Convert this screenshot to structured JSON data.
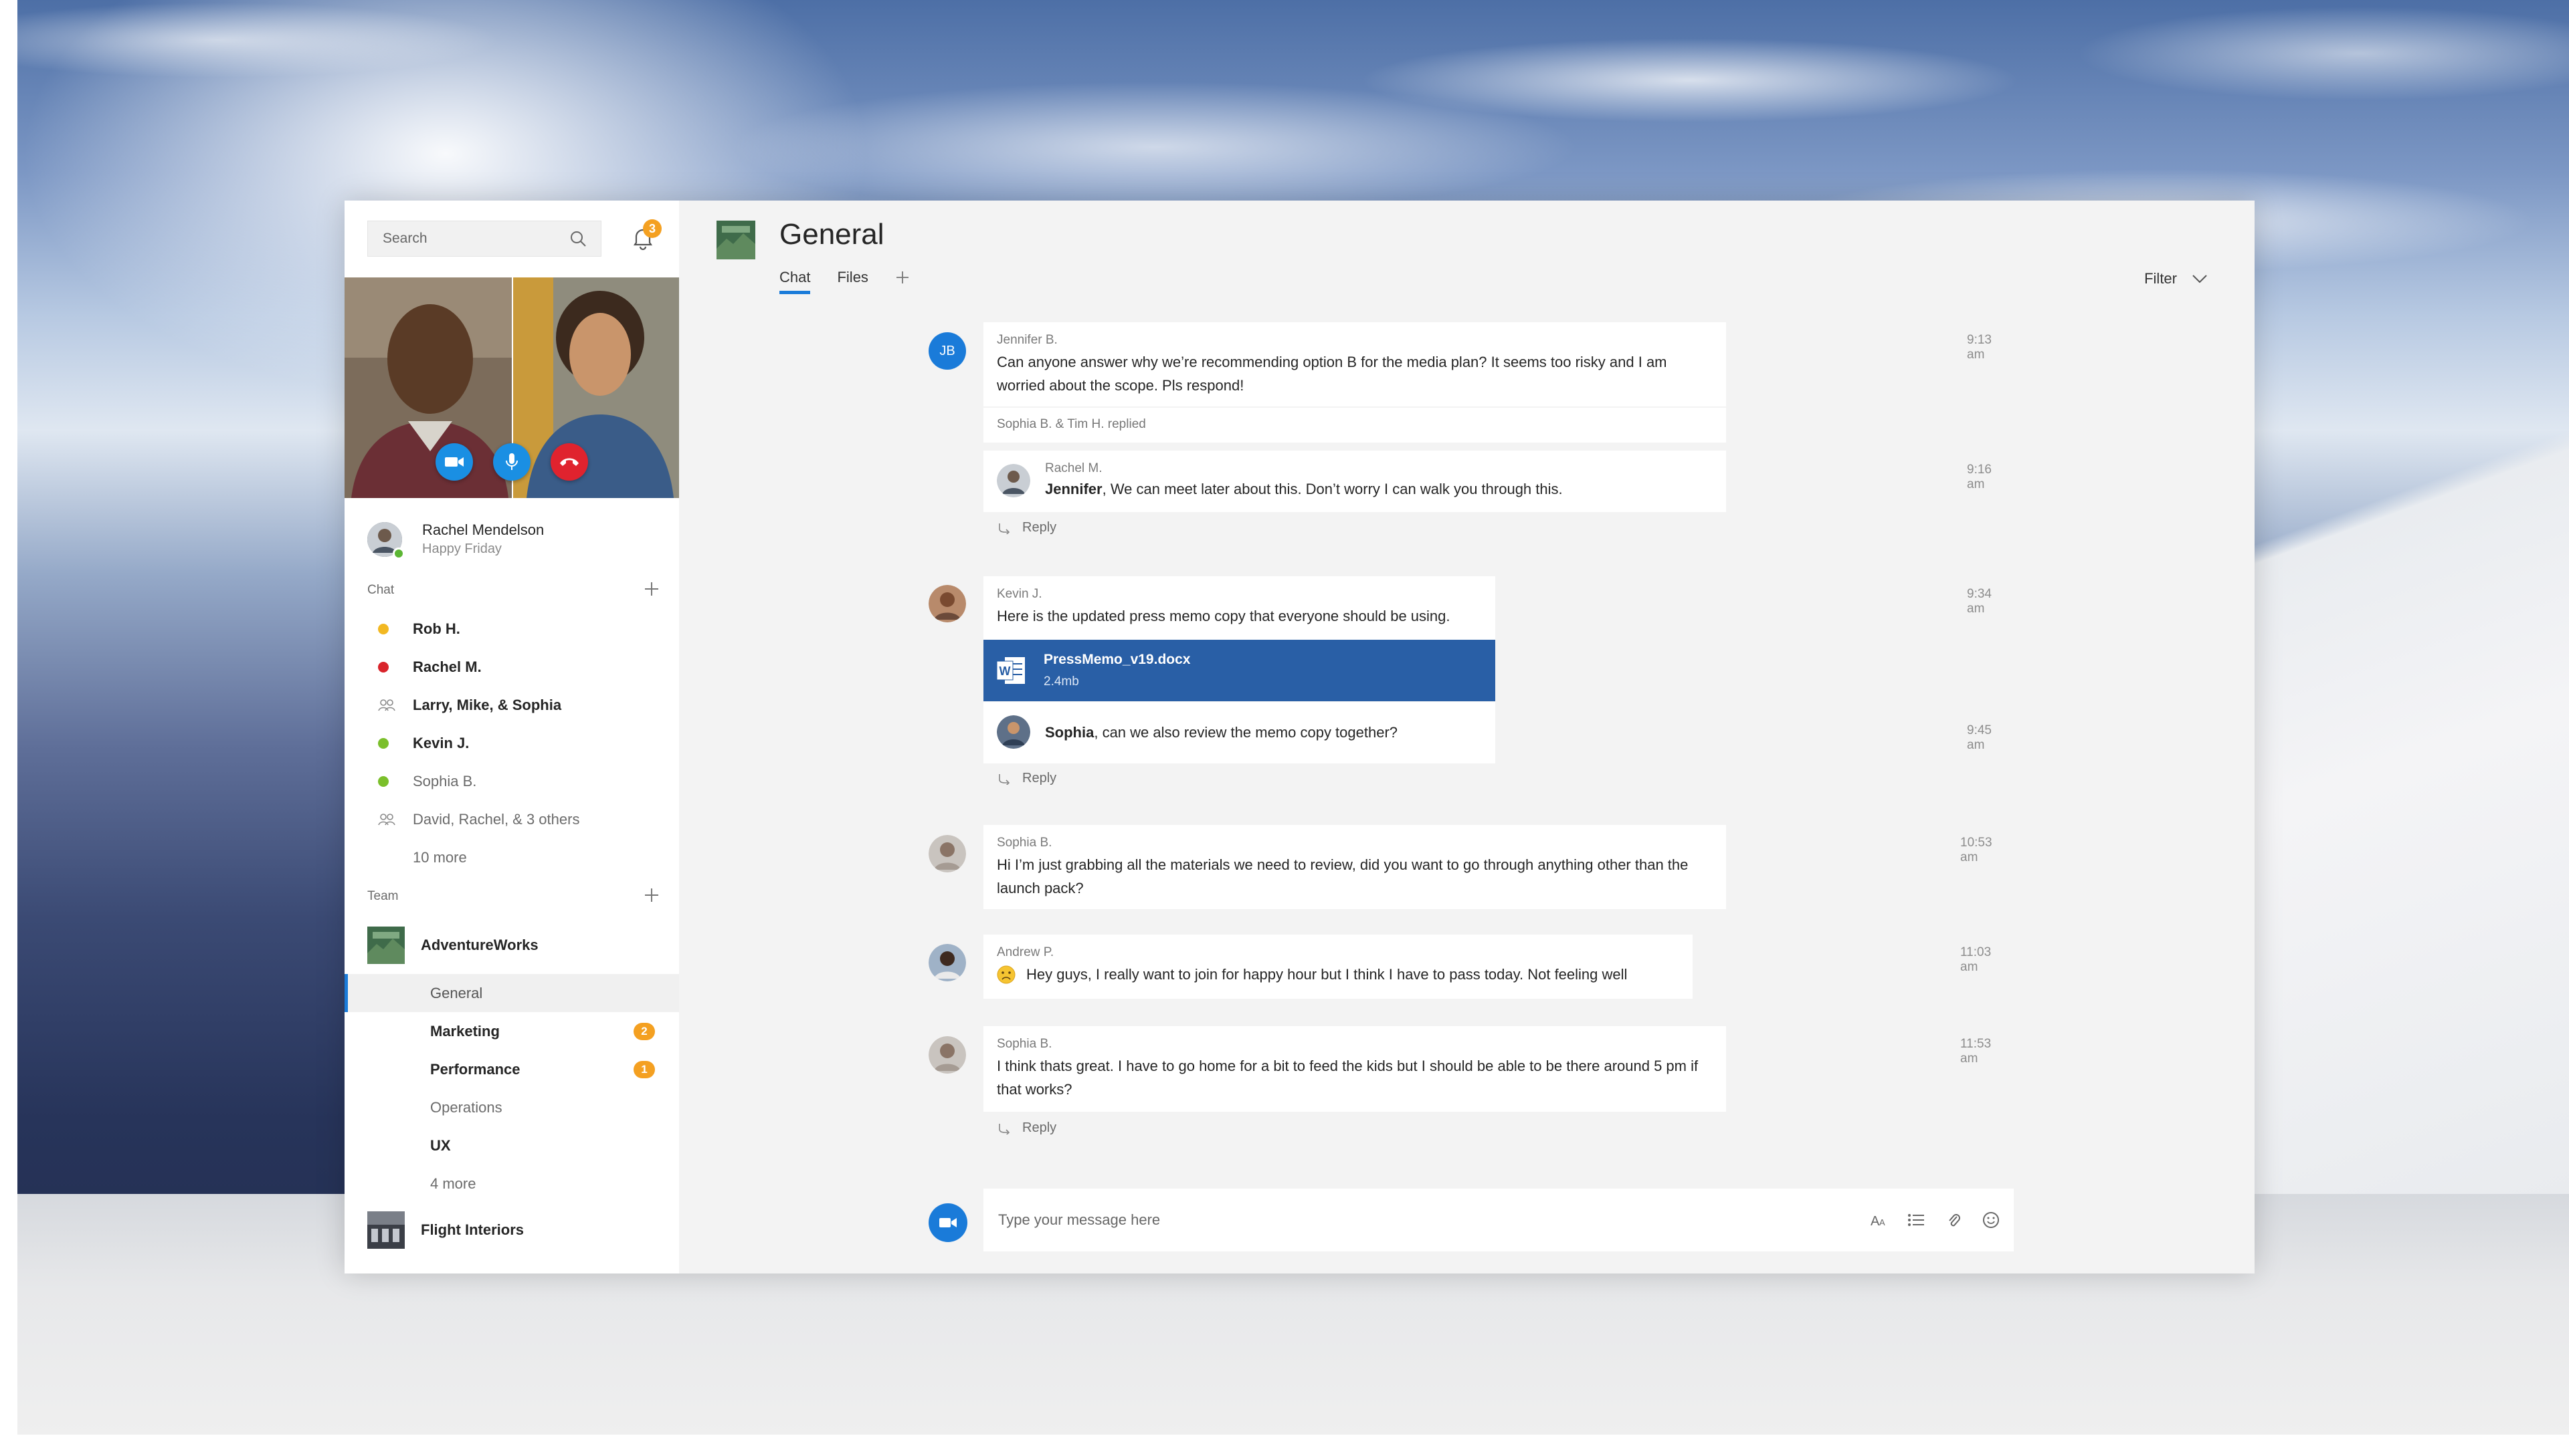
{
  "colors": {
    "accent": "#1a7bd9",
    "badge": "#f4a021",
    "file_card": "#295fa6",
    "end_call": "#e0232e"
  },
  "sidebar": {
    "search": {
      "placeholder": "Search"
    },
    "notifications": {
      "count": "3",
      "icon": "bell-icon"
    },
    "call": {
      "controls": [
        "video-icon",
        "mic-icon",
        "hangup-icon"
      ]
    },
    "me": {
      "name": "Rachel Mendelson",
      "status": "Happy Friday"
    },
    "chat_section": {
      "title": "Chat"
    },
    "chats": [
      {
        "label": "Rob H.",
        "bold": true,
        "status": "#f2b822"
      },
      {
        "label": "Rachel M.",
        "bold": true,
        "status": "#d9242b"
      },
      {
        "label": "Larry, Mike, & Sophia",
        "bold": true,
        "status": "group"
      },
      {
        "label": "Kevin J.",
        "bold": true,
        "status": "#7bbf2b"
      },
      {
        "label": "Sophia B.",
        "bold": false,
        "status": "#7bbf2b"
      },
      {
        "label": "David, Rachel, & 3 others",
        "bold": false,
        "status": "group"
      },
      {
        "label": "10 more",
        "bold": false,
        "status": "none"
      }
    ],
    "team_section": {
      "title": "Team"
    },
    "teams": [
      {
        "name": "AdventureWorks"
      },
      {
        "name": "Flight Interiors"
      }
    ],
    "channels": [
      {
        "label": "General",
        "bold": false,
        "selected": true,
        "badge": ""
      },
      {
        "label": "Marketing",
        "bold": true,
        "selected": false,
        "badge": "2"
      },
      {
        "label": "Performance",
        "bold": true,
        "selected": false,
        "badge": "1"
      },
      {
        "label": "Operations",
        "bold": false,
        "selected": false,
        "badge": ""
      },
      {
        "label": "UX",
        "bold": true,
        "selected": false,
        "badge": ""
      },
      {
        "label": "4 more",
        "bold": false,
        "selected": false,
        "badge": ""
      }
    ]
  },
  "main": {
    "title": "General",
    "tabs": [
      {
        "label": "Chat",
        "active": true
      },
      {
        "label": "Files",
        "active": false
      }
    ],
    "filter": {
      "label": "Filter"
    },
    "threads": [
      {
        "author": "Jennifer B.",
        "initials": "JB",
        "time": "9:13 am",
        "text": "Can anyone answer why we’re recommending option B for the media plan? It seems too risky and I am worried about the scope. Pls respond!",
        "replied_note": "Sophia B. & Tim H. replied",
        "reply": {
          "author": "Rachel M.",
          "mention": "Jennifer",
          "text": ", We can meet later about this. Don’t worry I can walk you through this.",
          "time": "9:16 am"
        },
        "reply_label": "Reply"
      },
      {
        "author": "Kevin J.",
        "time": "9:34 am",
        "text": "Here is the updated press memo copy that everyone should be using.",
        "file": {
          "name": "PressMemo_v19.docx",
          "size": "2.4mb",
          "icon": "word-doc-icon"
        },
        "reply": {
          "mention": "Sophia",
          "text": ", can we also review the memo copy together?",
          "time": "9:45 am"
        },
        "reply_label": "Reply"
      },
      {
        "author": "Sophia B.",
        "time": "10:53 am",
        "text": "Hi I’m just grabbing all the materials we need to review, did you want to go through anything other than the launch pack?"
      },
      {
        "author": "Andrew P.",
        "time": "11:03 am",
        "text": "Hey guys, I really want to join for happy hour but I think I have to pass today. Not feeling well",
        "emoji": "sad-face-icon"
      },
      {
        "author": "Sophia B.",
        "time": "11:53 am",
        "text": "I think thats great. I have to go home for a bit to feed the kids but I should be able to be there around 5 pm if that works?",
        "reply_label": "Reply"
      }
    ],
    "composer": {
      "placeholder": "Type your message here",
      "tools": [
        "format-icon",
        "list-icon",
        "attach-icon",
        "emoji-icon"
      ]
    }
  }
}
